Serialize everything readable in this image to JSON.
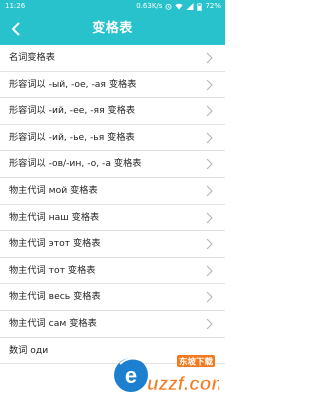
{
  "status": {
    "time": "11:26",
    "speed": "0.63K/s",
    "battery": "72%"
  },
  "header": {
    "title": "变格表"
  },
  "items": [
    {
      "label": "名词变格表"
    },
    {
      "label": "形容词以 -ый, -ое, -ая 变格表"
    },
    {
      "label": "形容词以 -ий, -ее, -яя 变格表"
    },
    {
      "label": "形容词以 -ий, -ье, -ья 变格表"
    },
    {
      "label": "形容词以 -ов/-ин, -о, -а 变格表"
    },
    {
      "label": "物主代词 мой 变格表"
    },
    {
      "label": "物主代词 наш 变格表"
    },
    {
      "label": "物主代词 этот 变格表"
    },
    {
      "label": "物主代词 тот 变格表"
    },
    {
      "label": "物主代词 весь 变格表"
    },
    {
      "label": "物主代词 сам 变格表"
    },
    {
      "label": "数词 оди"
    }
  ],
  "watermark": {
    "brand": "uzzf.com",
    "badge": "东坡下载"
  },
  "colors": {
    "accent": "#27c2cc",
    "watermark_orange": "#f47a20",
    "watermark_blue": "#1c7fd0"
  }
}
